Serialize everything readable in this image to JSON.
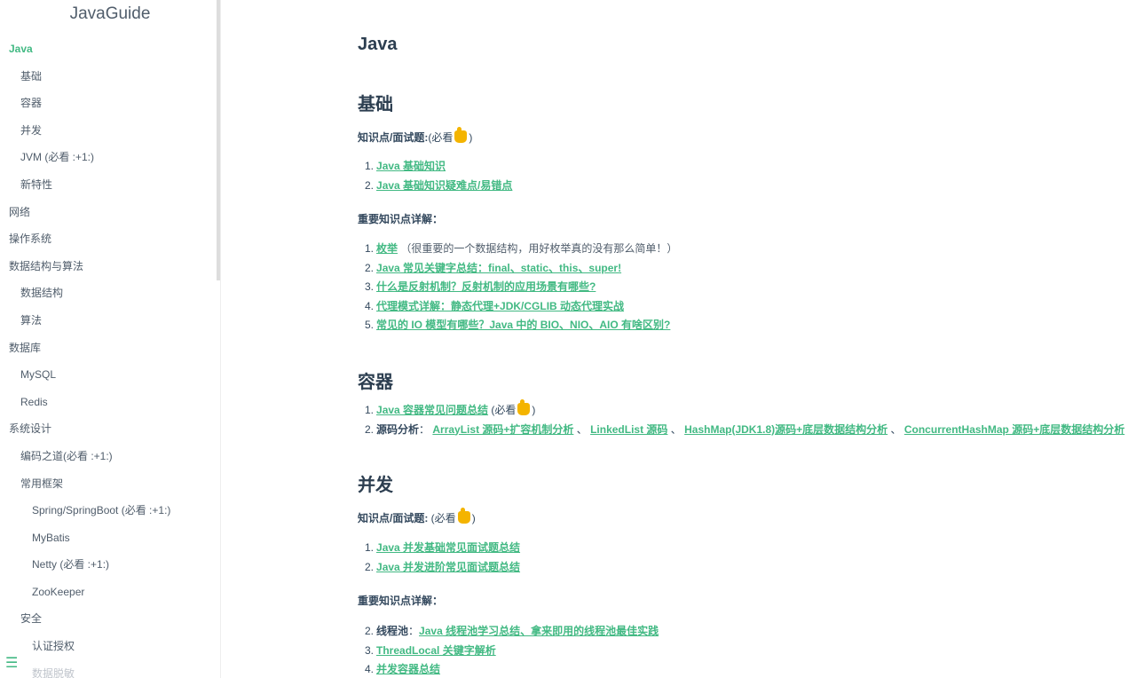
{
  "sidebar": {
    "app_name": "JavaGuide",
    "items": [
      {
        "label": "Java"
      },
      {
        "label": "基础"
      },
      {
        "label": "容器"
      },
      {
        "label": "并发"
      },
      {
        "label": "JVM (必看 :+1:)"
      },
      {
        "label": "新特性"
      },
      {
        "label": "网络"
      },
      {
        "label": "操作系统"
      },
      {
        "label": "数据结构与算法"
      },
      {
        "label": "数据结构"
      },
      {
        "label": "算法"
      },
      {
        "label": "数据库"
      },
      {
        "label": "MySQL"
      },
      {
        "label": "Redis"
      },
      {
        "label": "系统设计"
      },
      {
        "label": "编码之道(必看 :+1:)"
      },
      {
        "label": "常用框架"
      },
      {
        "label": "Spring/SpringBoot (必看 :+1:)"
      },
      {
        "label": "MyBatis"
      },
      {
        "label": "Netty (必看 :+1:)"
      },
      {
        "label": "ZooKeeper"
      },
      {
        "label": "安全"
      },
      {
        "label": "认证授权"
      },
      {
        "label": "数据脱敏"
      }
    ],
    "menu_icon": "hamburger-icon",
    "accent_color": "#42b983"
  },
  "content": {
    "title": "Java",
    "basics": {
      "heading": "基础",
      "intro_label": "知识点/面试题:",
      "intro_suffix_open": "(必看",
      "intro_suffix_close": ")",
      "list1": [
        {
          "num": "1.",
          "link": "Java 基础知识"
        },
        {
          "num": "2.",
          "link": "Java 基础知识疑难点/易错点"
        }
      ],
      "details_label": "重要知识点详解：",
      "list2": [
        {
          "num": "1.",
          "link": "枚举",
          "after": " （很重要的一个数据结构，用好枚举真的没有那么简单！）"
        },
        {
          "num": "2.",
          "link": "Java 常见关键字总结：final、static、this、super!"
        },
        {
          "num": "3.",
          "link": "什么是反射机制？反射机制的应用场景有哪些?"
        },
        {
          "num": "4.",
          "link": "代理模式详解：静态代理+JDK/CGLIB 动态代理实战"
        },
        {
          "num": "5.",
          "link": "常见的 IO 模型有哪些？Java 中的 BIO、NIO、AIO 有啥区别?"
        }
      ]
    },
    "containers": {
      "heading": "容器",
      "item1": {
        "num": "1.",
        "link": "Java 容器常见问题总结",
        "suffix_open": " (必看",
        "suffix_close": ")"
      },
      "item2": {
        "num": "2.",
        "label": "源码分析",
        "sep0": "： ",
        "links": [
          "ArrayList 源码+扩容机制分析",
          "LinkedList 源码",
          "HashMap(JDK1.8)源码+底层数据结构分析",
          "ConcurrentHashMap 源码+底层数据结构分析"
        ],
        "sep": " 、"
      }
    },
    "concurrency": {
      "heading": "并发",
      "intro_label": "知识点/面试题:",
      "intro_suffix_open": " (必看",
      "intro_suffix_close": ")",
      "list1": [
        {
          "num": "1.",
          "link": "Java 并发基础常见面试题总结"
        },
        {
          "num": "2.",
          "link": "Java 并发进阶常见面试题总结"
        }
      ],
      "details_label": "重要知识点详解：",
      "list2": [
        {
          "num": "2.",
          "label": "线程池",
          "sep": "：",
          "link": "Java 线程池学习总结、拿来即用的线程池最佳实践"
        },
        {
          "num": "3.",
          "link": "ThreadLocal 关键字解析"
        },
        {
          "num": "4.",
          "link": "并发容器总结"
        }
      ]
    }
  }
}
